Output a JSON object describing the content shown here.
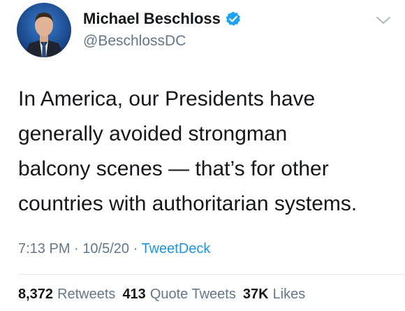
{
  "author": {
    "display_name": "Michael Beschloss",
    "handle": "@BeschlossDC",
    "verified": true
  },
  "tweet": {
    "text_lines": [
      "In America, our Presidents have",
      "generally avoided strongman",
      "balcony scenes — that’s for other",
      "countries with authoritarian systems."
    ],
    "time": "7:13 PM",
    "date": "10/5/20",
    "separator": "·",
    "source": "TweetDeck"
  },
  "stats": {
    "retweets_count": "8,372",
    "retweets_label": "Retweets",
    "quotes_count": "413",
    "quotes_label": "Quote Tweets",
    "likes_count": "37K",
    "likes_label": "Likes"
  },
  "colors": {
    "primary_text": "#14171a",
    "secondary_text": "#657786",
    "link": "#1b95e0",
    "verified_badge": "#1da1f2"
  },
  "icons": {
    "verified": "verified-badge-icon",
    "more": "chevron-down-icon"
  }
}
